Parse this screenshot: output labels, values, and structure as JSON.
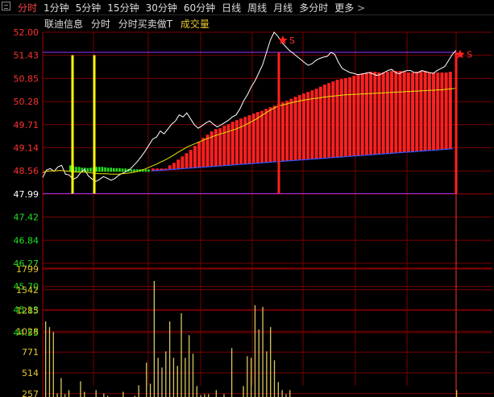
{
  "toolbar": {
    "icon": "window-icon",
    "tabs": [
      {
        "label": "分时",
        "active": true
      },
      {
        "label": "1分钟"
      },
      {
        "label": "5分钟"
      },
      {
        "label": "15分钟"
      },
      {
        "label": "30分钟"
      },
      {
        "label": "60分钟"
      },
      {
        "label": "日线"
      },
      {
        "label": "周线"
      },
      {
        "label": "月线"
      },
      {
        "label": "多分时"
      },
      {
        "label": "更多"
      }
    ],
    "more_icon": "chevron-right-icon"
  },
  "legend": {
    "stock_name": "联迪信息",
    "mode": "分时",
    "mode2": "分时买卖做T",
    "volume": "成交量"
  },
  "colors": {
    "up": "#ff2020",
    "down": "#20e020",
    "grid": "#7a0000",
    "price_line": "#ffffff",
    "avg_line": "#e6e600",
    "volume": "#d8c860",
    "marker": "#ffff00",
    "purple": "#9933ff"
  },
  "chart_data": [
    {
      "type": "line",
      "name": "price",
      "yticks_up": [
        "52.00",
        "51.43",
        "50.85",
        "50.28",
        "49.71",
        "49.14",
        "48.56"
      ],
      "yticks_mid": "47.99",
      "yticks_down": [
        "47.42",
        "46.84",
        "46.27",
        "45.70",
        "45.13",
        "44.55"
      ],
      "ylim": [
        44.55,
        52.0
      ],
      "prev_close": 47.99,
      "price": [
        48.4,
        48.58,
        48.62,
        48.55,
        48.66,
        48.7,
        48.48,
        48.46,
        48.35,
        48.4,
        48.52,
        48.6,
        48.44,
        48.36,
        48.3,
        48.35,
        48.42,
        48.38,
        48.33,
        48.37,
        48.45,
        48.5,
        48.55,
        48.6,
        48.7,
        48.8,
        48.92,
        49.05,
        49.2,
        49.35,
        49.4,
        49.55,
        49.48,
        49.6,
        49.72,
        49.8,
        49.95,
        49.9,
        50.0,
        49.85,
        49.7,
        49.62,
        49.68,
        49.75,
        49.8,
        49.72,
        49.65,
        49.7,
        49.76,
        49.82,
        49.9,
        49.95,
        50.1,
        50.3,
        50.45,
        50.65,
        50.8,
        51.0,
        51.2,
        51.5,
        51.8,
        52.0,
        51.9,
        51.75,
        51.65,
        51.55,
        51.48,
        51.4,
        51.33,
        51.25,
        51.18,
        51.22,
        51.3,
        51.35,
        51.38,
        51.4,
        51.5,
        51.45,
        51.25,
        51.1,
        51.05,
        51.0,
        50.98,
        50.95,
        50.96,
        50.98,
        51.0,
        50.97,
        50.93,
        50.95,
        51.0,
        51.05,
        51.08,
        51.0,
        50.97,
        51.02,
        51.05,
        51.05,
        51.0,
        51.0,
        51.05,
        51.02,
        51.0,
        50.98,
        51.05,
        51.1,
        51.15,
        51.3,
        51.45,
        51.55
      ],
      "avg": [
        48.52,
        48.55,
        48.56,
        48.56,
        48.57,
        48.57,
        48.56,
        48.55,
        48.54,
        48.53,
        48.53,
        48.53,
        48.52,
        48.51,
        48.5,
        48.49,
        48.49,
        48.49,
        48.48,
        48.48,
        48.48,
        48.49,
        48.5,
        48.51,
        48.53,
        48.55,
        48.58,
        48.61,
        48.65,
        48.69,
        48.73,
        48.78,
        48.82,
        48.87,
        48.92,
        48.98,
        49.04,
        49.09,
        49.15,
        49.19,
        49.23,
        49.27,
        49.31,
        49.35,
        49.38,
        49.42,
        49.45,
        49.48,
        49.51,
        49.54,
        49.57,
        49.6,
        49.64,
        49.68,
        49.73,
        49.78,
        49.83,
        49.89,
        49.95,
        50.01,
        50.07,
        50.12,
        50.16,
        50.19,
        50.21,
        50.24,
        50.26,
        50.28,
        50.3,
        50.32,
        50.33,
        50.35,
        50.36,
        50.37,
        50.39,
        50.4,
        50.41,
        50.42,
        50.43,
        50.44,
        50.45,
        50.45,
        50.46,
        50.46,
        50.47,
        50.47,
        50.48,
        50.48,
        50.49,
        50.49,
        50.5,
        50.5,
        50.51,
        50.51,
        50.52,
        50.52,
        50.53,
        50.53,
        50.54,
        50.54,
        50.55,
        50.55,
        50.56,
        50.56,
        50.57,
        50.57,
        50.58,
        50.59,
        50.6,
        50.61
      ]
    },
    {
      "type": "bar",
      "name": "volume",
      "yticks": [
        "1799",
        "1542",
        "1285",
        "1028",
        "771",
        "514",
        "257"
      ],
      "ylim": [
        0,
        1799
      ],
      "values": [
        1150,
        1080,
        1020,
        260,
        450,
        250,
        300,
        180,
        150,
        410,
        280,
        150,
        120,
        300,
        180,
        260,
        230,
        200,
        160,
        180,
        280,
        200,
        160,
        230,
        360,
        200,
        640,
        380,
        1650,
        700,
        580,
        780,
        1150,
        700,
        600,
        1250,
        700,
        980,
        750,
        350,
        240,
        250,
        250,
        200,
        300,
        180,
        250,
        150,
        820,
        200,
        150,
        350,
        720,
        700,
        1350,
        1050,
        1330,
        780,
        1080,
        670,
        400,
        300,
        250,
        300,
        170,
        160,
        140,
        150,
        200,
        180,
        120,
        160,
        130,
        180,
        200,
        140,
        120,
        180,
        130,
        120,
        110,
        150,
        100,
        80,
        60,
        90,
        110,
        70,
        60,
        80,
        120,
        100,
        130,
        80,
        60,
        80,
        90,
        110,
        70,
        90,
        100,
        80,
        120,
        140,
        180,
        190,
        300
      ]
    },
    {
      "type": "bar",
      "name": "t-trade-bars",
      "up_levels": [
        48.62,
        48.62,
        48.62,
        48.62,
        48.7,
        48.76,
        48.84,
        48.92,
        49.0,
        49.08,
        49.18,
        49.28,
        49.38,
        49.46,
        49.54,
        49.6,
        49.62,
        49.68,
        49.72,
        49.78,
        49.82,
        49.86,
        49.9,
        49.94,
        49.98,
        50.02,
        50.05,
        50.1,
        50.14,
        50.18,
        50.22,
        50.26,
        50.3,
        50.35,
        50.4,
        50.44,
        50.48,
        50.52,
        50.56,
        50.6,
        50.65,
        50.7,
        50.74,
        50.78,
        50.82,
        50.84,
        50.86,
        50.88,
        50.92,
        50.95,
        50.98,
        51.0,
        51.02,
        51.02,
        51.0,
        51.0,
        51.02,
        51.04,
        51.04,
        51.04,
        51.02,
        51.0,
        51.0,
        51.02,
        51.04,
        51.04,
        51.0,
        51.0,
        51.0,
        51.0,
        51.0,
        51.02
      ],
      "down_levels": [
        48.7,
        48.68,
        48.66,
        48.66,
        48.64,
        48.64,
        48.63,
        48.64,
        48.65,
        48.66,
        48.66,
        48.66,
        48.65,
        48.64,
        48.64,
        48.63,
        48.63,
        48.63,
        48.62,
        48.62,
        48.61,
        48.6,
        48.6,
        48.6,
        48.6,
        48.6,
        48.6,
        48.6
      ]
    }
  ],
  "annotations": {
    "buy_marker_label": "S",
    "sell_marker_label": "S"
  }
}
